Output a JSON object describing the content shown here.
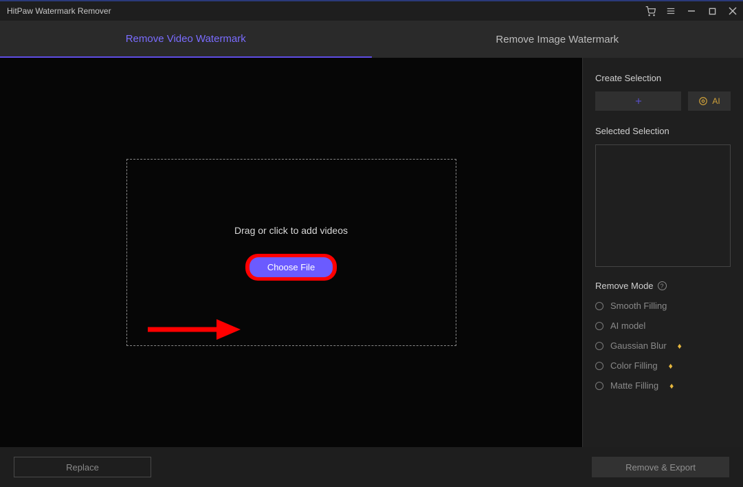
{
  "app": {
    "title": "HitPaw Watermark Remover"
  },
  "tabs": {
    "video": "Remove Video Watermark",
    "image": "Remove Image Watermark"
  },
  "main": {
    "drop_hint": "Drag or click to add videos",
    "choose_file": "Choose File"
  },
  "sidebar": {
    "create_selection": "Create Selection",
    "ai_label": "AI",
    "selected_selection": "Selected Selection",
    "remove_mode": "Remove Mode",
    "modes": {
      "smooth": "Smooth Filling",
      "ai": "AI model",
      "gaussian": "Gaussian Blur",
      "color": "Color Filling",
      "matte": "Matte Filling"
    }
  },
  "footer": {
    "replace": "Replace",
    "export": "Remove & Export"
  },
  "colors": {
    "accent": "#6b5bff",
    "highlight": "#ff0000",
    "gold": "#e6b73e"
  }
}
